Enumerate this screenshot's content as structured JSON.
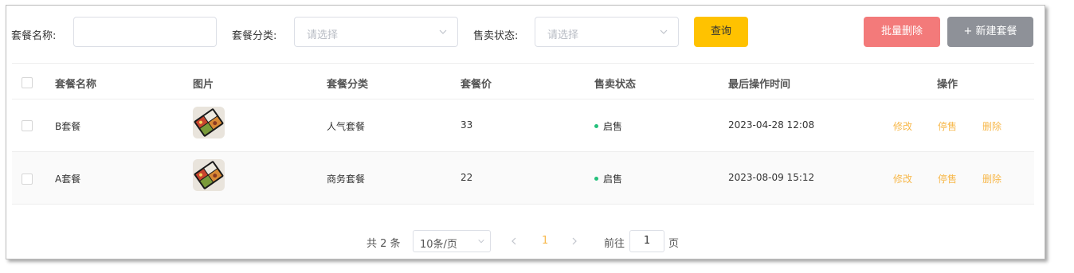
{
  "toolbar": {
    "name_label": "套餐名称:",
    "name_value": "",
    "category_label": "套餐分类:",
    "category_placeholder": "请选择",
    "status_label": "售卖状态:",
    "status_placeholder": "请选择",
    "query_button": "查询",
    "batch_delete_button": "批量删除",
    "new_button": "+ 新建套餐"
  },
  "table": {
    "headers": [
      "套餐名称",
      "图片",
      "套餐分类",
      "套餐价",
      "售卖状态",
      "最后操作时间",
      "操作"
    ],
    "rows": [
      {
        "name": "B套餐",
        "image_icon": "bento-box-photo",
        "category": "人气套餐",
        "price": "33",
        "status": "启售",
        "updated": "2023-04-28 12:08",
        "actions": [
          "修改",
          "停售",
          "删除"
        ]
      },
      {
        "name": "A套餐",
        "image_icon": "bento-box-photo",
        "category": "商务套餐",
        "price": "22",
        "status": "启售",
        "updated": "2023-08-09 15:12",
        "actions": [
          "修改",
          "停售",
          "删除"
        ]
      }
    ]
  },
  "pagination": {
    "total": "共 2 条",
    "page_size": "10条/页",
    "current_page": "1",
    "goto_label": "前往",
    "goto_value": "1",
    "goto_suffix": "页"
  },
  "colors": {
    "accent": "#ffc200",
    "danger": "#f37a7a",
    "neutral": "#8e9198",
    "status_on": "#24c07b",
    "action": "#f7b84b"
  }
}
